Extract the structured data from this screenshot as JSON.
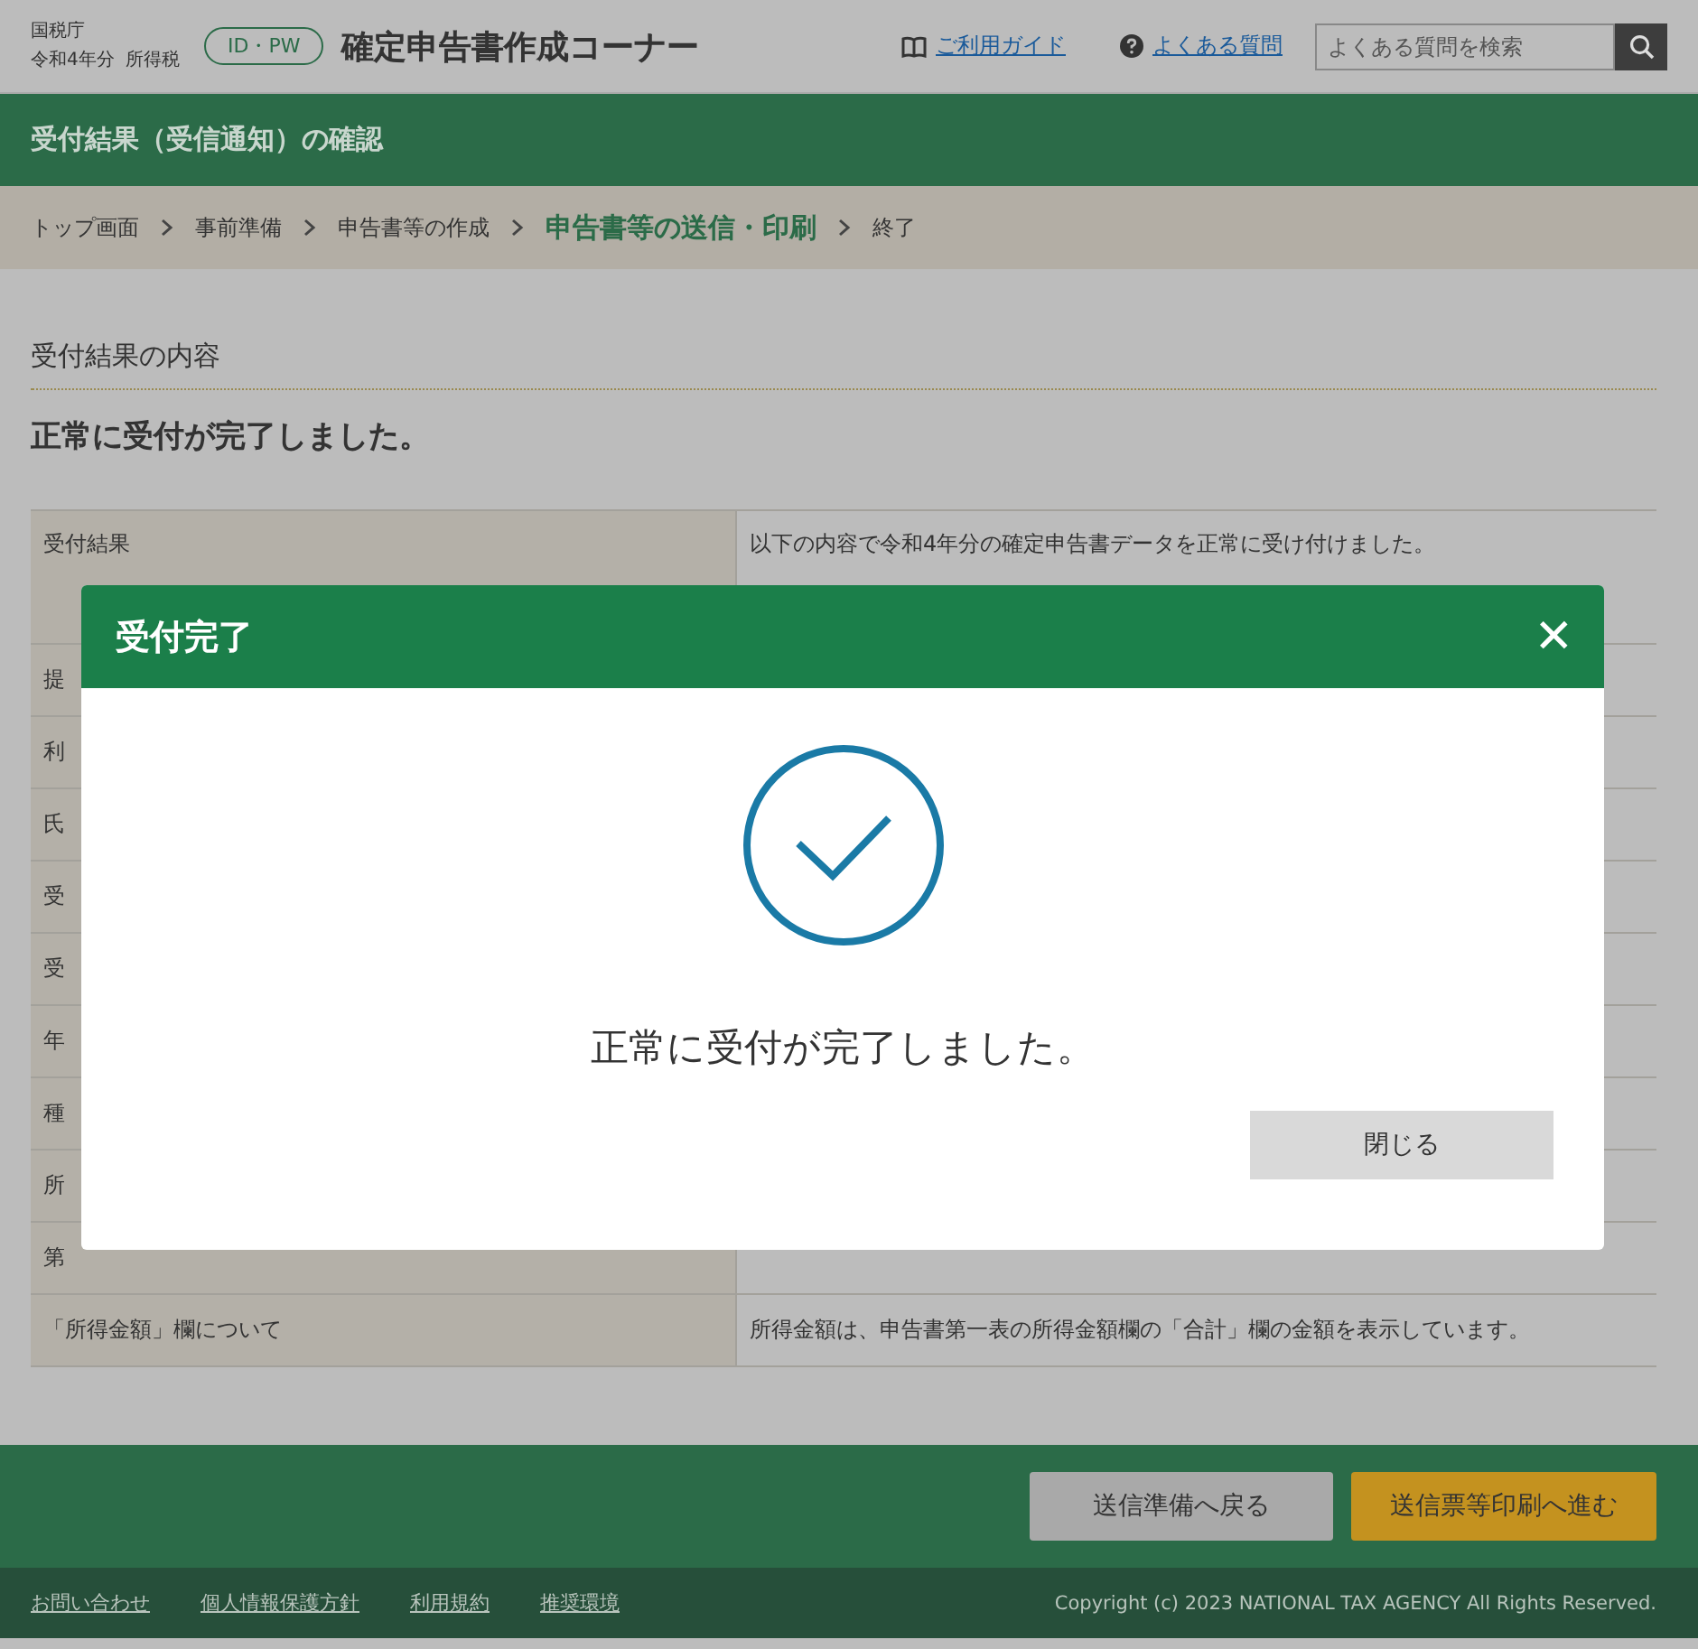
{
  "header": {
    "agency": "国税庁",
    "year_tax": [
      "令和4年分",
      "所得税"
    ],
    "badge": "ID・PW",
    "title": "確定申告書作成コーナー",
    "links": [
      "ご利用ガイド",
      "よくある質問"
    ],
    "search": {
      "placeholder": "よくある質問を検索"
    }
  },
  "page_title": "受付結果（受信通知）の確認",
  "breadcrumb": [
    {
      "label": "トップ画面",
      "selected": false
    },
    {
      "label": "事前準備",
      "selected": false
    },
    {
      "label": "申告書等の作成",
      "selected": false
    },
    {
      "label": "申告書等の送信・印刷",
      "selected": true
    },
    {
      "label": "終了",
      "selected": false
    }
  ],
  "section_title": "受付結果の内容",
  "heading": "正常に受付が完了しました。",
  "table": {
    "rows": [
      {
        "label": "受付結果",
        "value": "以下の内容で令和4年分の確定申告書データを正常に受け付けました。"
      },
      {
        "label": "提"
      },
      {
        "label": "利"
      },
      {
        "label": "氏"
      },
      {
        "label": "受"
      },
      {
        "label": "受"
      },
      {
        "label": "年"
      },
      {
        "label": "種"
      },
      {
        "label": "所"
      },
      {
        "label": "第"
      },
      {
        "label": "「所得金額」欄について",
        "value": "所得金額は、申告書第一表の所得金額欄の「合計」欄の金額を表示しています。"
      }
    ]
  },
  "actions": [
    {
      "label": "送信準備へ戻る",
      "kind": "secondary"
    },
    {
      "label": "送信票等印刷へ進む",
      "kind": "primary"
    }
  ],
  "footer": {
    "links": [
      "お問い合わせ",
      "個人情報保護方針",
      "利用規約",
      "推奨環境"
    ],
    "copyright": "Copyright (c) 2023 NATIONAL TAX AGENCY All Rights Reserved."
  },
  "dialog": {
    "title": "受付完了",
    "close": "✕",
    "message": "正常に受付が完了しました。",
    "button": "閉じる"
  }
}
